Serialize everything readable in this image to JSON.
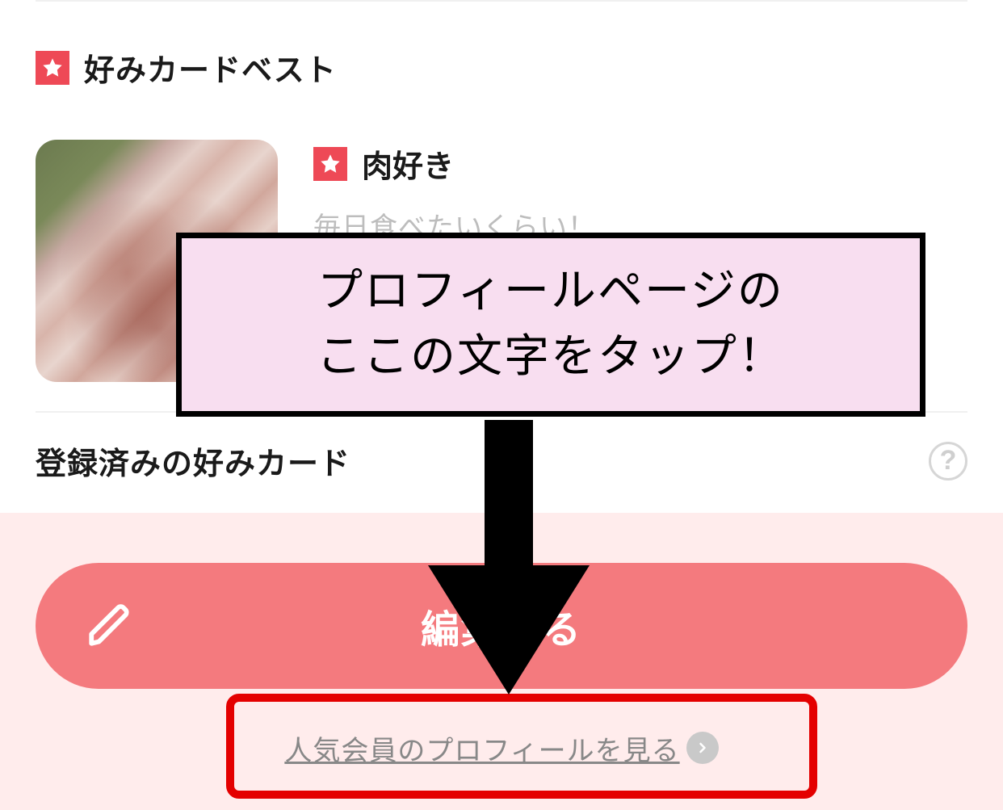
{
  "section": {
    "best_title": "好みカードベスト",
    "registered_title": "登録済みの好みカード"
  },
  "card": {
    "tag": "肉好き",
    "desc": "毎日食べたいくらい！"
  },
  "callout": {
    "line1": "プロフィールページの",
    "line2": "ここの文字をタップ！"
  },
  "buttons": {
    "edit": "編集する",
    "popular_link": "人気会員のプロフィールを見る"
  },
  "help": {
    "symbol": "?"
  }
}
